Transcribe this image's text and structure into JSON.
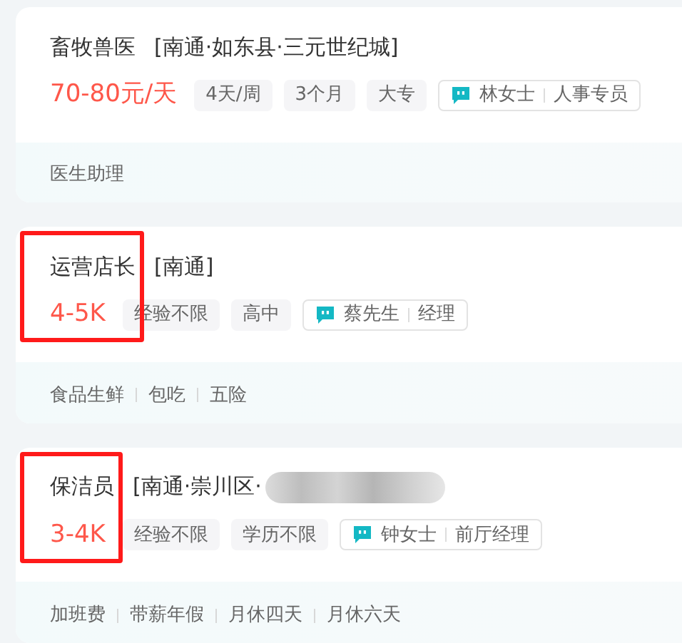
{
  "jobs": [
    {
      "title": "畜牧兽医",
      "location": "[南通·如东县·三元世纪城]",
      "location_redacted": false,
      "salary": "70-80元/天",
      "tags": [
        "4天/周",
        "3个月",
        "大专"
      ],
      "contact": {
        "name": "林女士",
        "role": "人事专员"
      },
      "benefits": [
        "医生助理"
      ],
      "highlighted": false
    },
    {
      "title": "运营店长",
      "location": "[南通]",
      "location_redacted": false,
      "salary": "4-5K",
      "tags": [
        "经验不限",
        "高中"
      ],
      "contact": {
        "name": "蔡先生",
        "role": "经理"
      },
      "benefits": [
        "食品生鲜",
        "包吃",
        "五险"
      ],
      "highlighted": true
    },
    {
      "title": "保洁员",
      "location": "[南通·崇川区·",
      "location_redacted": true,
      "salary": "3-4K",
      "tags": [
        "经验不限",
        "学历不限"
      ],
      "contact": {
        "name": "钟女士",
        "role": "前厅经理"
      },
      "benefits": [
        "加班费",
        "带薪年假",
        "月休四天",
        "月休六天"
      ],
      "highlighted": true
    }
  ]
}
